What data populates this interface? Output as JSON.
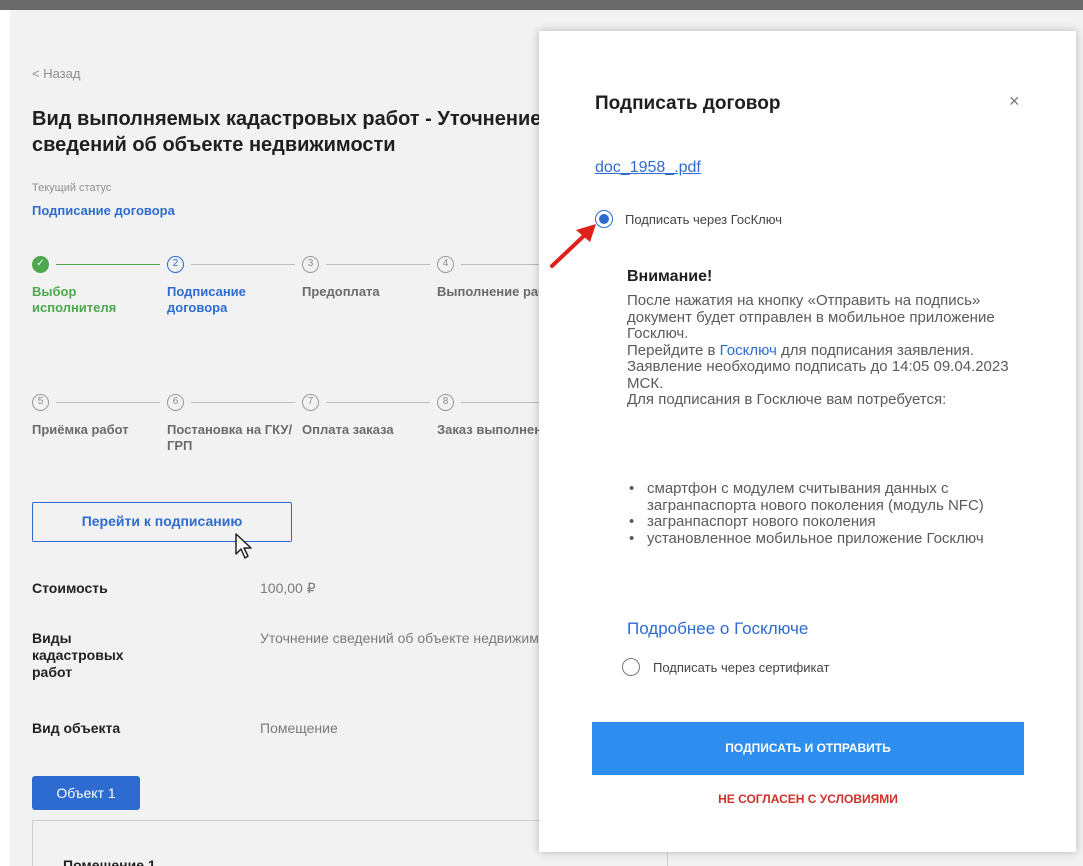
{
  "page": {
    "back_label": "< Назад",
    "title": "Вид выполняемых кадастровых работ - Уточнение сведений об объекте недвижимости",
    "status_caption": "Текущий статус",
    "status_value": "Подписание договора",
    "steps": [
      {
        "num": "1",
        "label": "Выбор исполнителя",
        "state": "done"
      },
      {
        "num": "2",
        "label": "Подписание договора",
        "state": "active"
      },
      {
        "num": "3",
        "label": "Предоплата",
        "state": "pending"
      },
      {
        "num": "4",
        "label": "Выполнение работ",
        "state": "pending"
      },
      {
        "num": "5",
        "label": "Приёмка работ",
        "state": "pending"
      },
      {
        "num": "6",
        "label": "Постановка на ГКУ/ГРП",
        "state": "pending"
      },
      {
        "num": "7",
        "label": "Оплата заказа",
        "state": "pending"
      },
      {
        "num": "8",
        "label": "Заказ выполнен",
        "state": "pending"
      }
    ],
    "goto_button": "Перейти к подписанию",
    "fields": [
      {
        "label": "Стоимость",
        "value": "100,00 ₽"
      },
      {
        "label": "Виды кадастровых работ",
        "value": "Уточнение сведений об объекте недвижимости"
      },
      {
        "label": "Вид объекта",
        "value": "Помещение"
      }
    ],
    "object_tab": "Объект 1",
    "object_card_title": "Помещение 1"
  },
  "modal": {
    "title": "Подписать договор",
    "close_glyph": "×",
    "doc_link": "doc_1958_.pdf",
    "option_goskey": "Подписать через ГосКлюч",
    "warning_title": "Внимание!",
    "warning_p1": "После нажатия на кнопку «Отправить на подпись» документ будет отправлен в мобильное приложение Госключ.",
    "warning_p2_prefix": "Перейдите в ",
    "warning_p2_link": "Госключ",
    "warning_p2_suffix": " для подписания заявления. Заявление необходимо подписать до 14:05 09.04.2023 МСК.",
    "warning_p3": "Для подписания в Госключе вам потребуется:",
    "requirements": [
      "смартфон с модулем считывания данных с загранпаспорта нового поколения (модуль NFC)",
      "загранпаспорт нового поколения",
      "установленное мобильное приложение Госключ"
    ],
    "more_link": "Подробнее о Госключе",
    "option_cert": "Подписать через сертификат",
    "sign_button": "ПОДПИСАТЬ И ОТПРАВИТЬ",
    "decline_link": "НЕ СОГЛАСЕН С УСЛОВИЯМИ"
  },
  "colors": {
    "accent": "#2d6bd1",
    "button": "#2d8ef0",
    "done": "#4ea84e",
    "decline": "#d0302a",
    "arrow": "#e0201a"
  }
}
